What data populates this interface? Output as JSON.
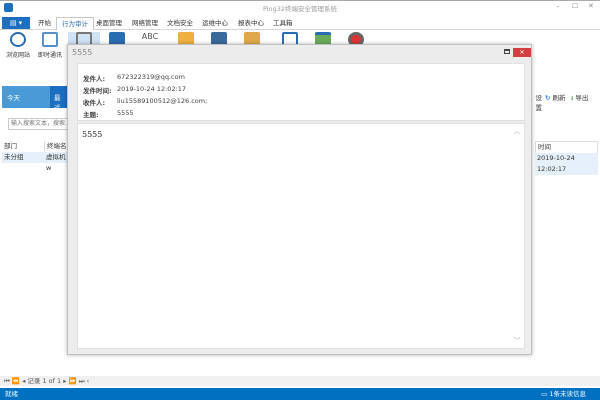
{
  "app": {
    "title": "Ping32终端安全管理系统"
  },
  "ribbon": {
    "file_label": "▤ ▾",
    "tabs": [
      "开始",
      "行为审计",
      "桌面管理",
      "网络管理",
      "文档安全",
      "运维中心",
      "报表中心",
      "工具箱"
    ],
    "active_tab": 1,
    "buttons": [
      {
        "label": "浏览网站",
        "icon": "globe-search-icon"
      },
      {
        "label": "即时通讯",
        "icon": "chat-icon"
      },
      {
        "label": "",
        "icon": "email-icon"
      },
      {
        "label": "",
        "icon": "toolbox-icon"
      },
      {
        "label": "ABC",
        "icon": "spell-icon"
      },
      {
        "label": "",
        "icon": "document-icon"
      },
      {
        "label": "",
        "icon": "printer-icon"
      },
      {
        "label": "",
        "icon": "clipboard-icon"
      },
      {
        "label": "",
        "icon": "window-icon"
      },
      {
        "label": "",
        "icon": "image-icon"
      },
      {
        "label": "",
        "icon": "record-icon"
      }
    ]
  },
  "left": {
    "today": "今天",
    "recent": "最近",
    "search_placeholder": "输入搜索文本，搜索...",
    "columns": [
      "部门",
      "终端名"
    ],
    "rows": [
      [
        "未分组",
        "虚拟机w"
      ]
    ]
  },
  "right": {
    "settings": "设置",
    "refresh": "刷新",
    "export": "导出",
    "column": "时间",
    "rows": [
      "2019-10-24 12:02:17"
    ]
  },
  "dialog": {
    "title": "5555",
    "fields": [
      {
        "label": "发件人:",
        "value": "672322319@qq.com"
      },
      {
        "label": "发件时间:",
        "value": "2019-10-24 12:02:17"
      },
      {
        "label": "收件人:",
        "value": "liu15589100512@126.com;"
      },
      {
        "label": "主题:",
        "value": "5555"
      }
    ],
    "body": "5555"
  },
  "pager": {
    "text": "记录 1 of 1"
  },
  "status": {
    "left": "就绪",
    "right": "1条未读信息"
  }
}
